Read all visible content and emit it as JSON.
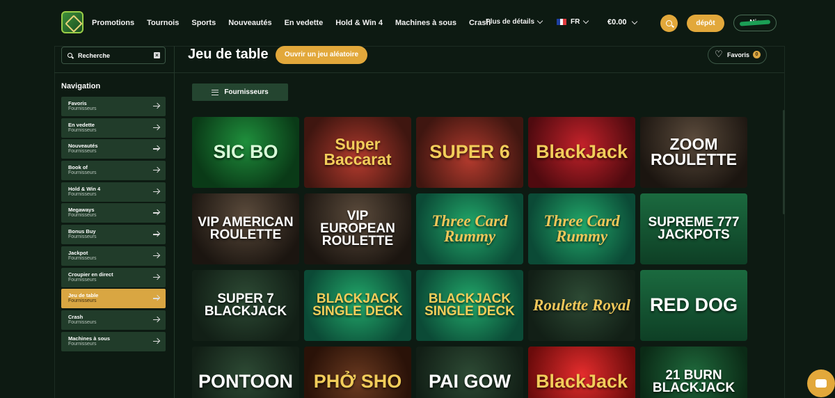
{
  "header": {
    "nav": [
      "Promotions",
      "Tournois",
      "Sports",
      "Nouveautés",
      "En vedette",
      "Hold & Win 4",
      "Machines à sous",
      "Crash"
    ],
    "more_label": "Plus de détails",
    "lang": "FR",
    "flag_colors": [
      "#1e3fa0",
      "#ffffff",
      "#e03a3e"
    ],
    "balance": "€0.00",
    "deposit_label": "dépôt",
    "user_label": "Nic"
  },
  "sidebar": {
    "search_placeholder": "Recherche",
    "nav_title": "Navigation",
    "items": [
      {
        "label": "Favoris",
        "sub": "Fournisseurs",
        "active": false
      },
      {
        "label": "En vedette",
        "sub": "Fournisseurs",
        "active": false
      },
      {
        "label": "Nouveautés",
        "sub": "Fournisseurs",
        "active": false
      },
      {
        "label": "Book of",
        "sub": "Fournisseurs",
        "active": false
      },
      {
        "label": "Hold & Win 4",
        "sub": "Fournisseurs",
        "active": false
      },
      {
        "label": "Megaways",
        "sub": "Fournisseurs",
        "active": false
      },
      {
        "label": "Bonus Buy",
        "sub": "Fournisseurs",
        "active": false
      },
      {
        "label": "Jackpot",
        "sub": "Fournisseurs",
        "active": false
      },
      {
        "label": "Croupier en direct",
        "sub": "Fournisseurs",
        "active": false
      },
      {
        "label": "Jeu de table",
        "sub": "Fournisseurs",
        "active": true
      },
      {
        "label": "Crash",
        "sub": "Fournisseurs",
        "active": false
      },
      {
        "label": "Machines à sous",
        "sub": "Fournisseurs",
        "active": false
      }
    ]
  },
  "main": {
    "title": "Jeu de table",
    "random_label": "Ouvrir un jeu aléatoire",
    "favorites_label": "Favoris",
    "favorites_count": "0",
    "providers_label": "Fournisseurs"
  },
  "games": [
    {
      "name": "SIC BO",
      "style": "c-green t-green"
    },
    {
      "name": "Super Baccarat",
      "style": "c-casino t-gold"
    },
    {
      "name": "SUPER 6",
      "style": "c-casino t-gold"
    },
    {
      "name": "BlackJack",
      "style": "c-red t-gold"
    },
    {
      "name": "ZOOM ROULETTE",
      "style": "c-roul t-white"
    },
    {
      "name": "VIP AMERICAN ROULETTE",
      "style": "c-roul t-white"
    },
    {
      "name": "VIP EUROPEAN ROULETTE",
      "style": "c-roul t-white"
    },
    {
      "name": "Three Card Rummy",
      "style": "c-teal t-goldserif"
    },
    {
      "name": "Three Card Rummy",
      "style": "c-teal t-goldserif"
    },
    {
      "name": "SUPREME 777 JACKPOTS",
      "style": "c-felt t-white"
    },
    {
      "name": "SUPER 7 BLACKJACK",
      "style": "c-darkgreen t-white"
    },
    {
      "name": "BLACKJACK SINGLE DECK",
      "style": "c-teal t-gold"
    },
    {
      "name": "BLACKJACK SINGLE DECK",
      "style": "c-teal t-gold"
    },
    {
      "name": "Roulette Royal",
      "style": "c-darkgreen t-goldserif"
    },
    {
      "name": "RED DOG",
      "style": "c-felt t-white"
    },
    {
      "name": "PONTOON",
      "style": "c-darkgreen t-white"
    },
    {
      "name": "PHỞ SHO",
      "style": "c-casino2 t-gold"
    },
    {
      "name": "PAI GOW",
      "style": "c-darkgreen t-white"
    },
    {
      "name": "BlackJack",
      "style": "c-red2 t-gold"
    },
    {
      "name": "21 BURN BLACKJACK",
      "style": "c-burn t-white"
    }
  ]
}
